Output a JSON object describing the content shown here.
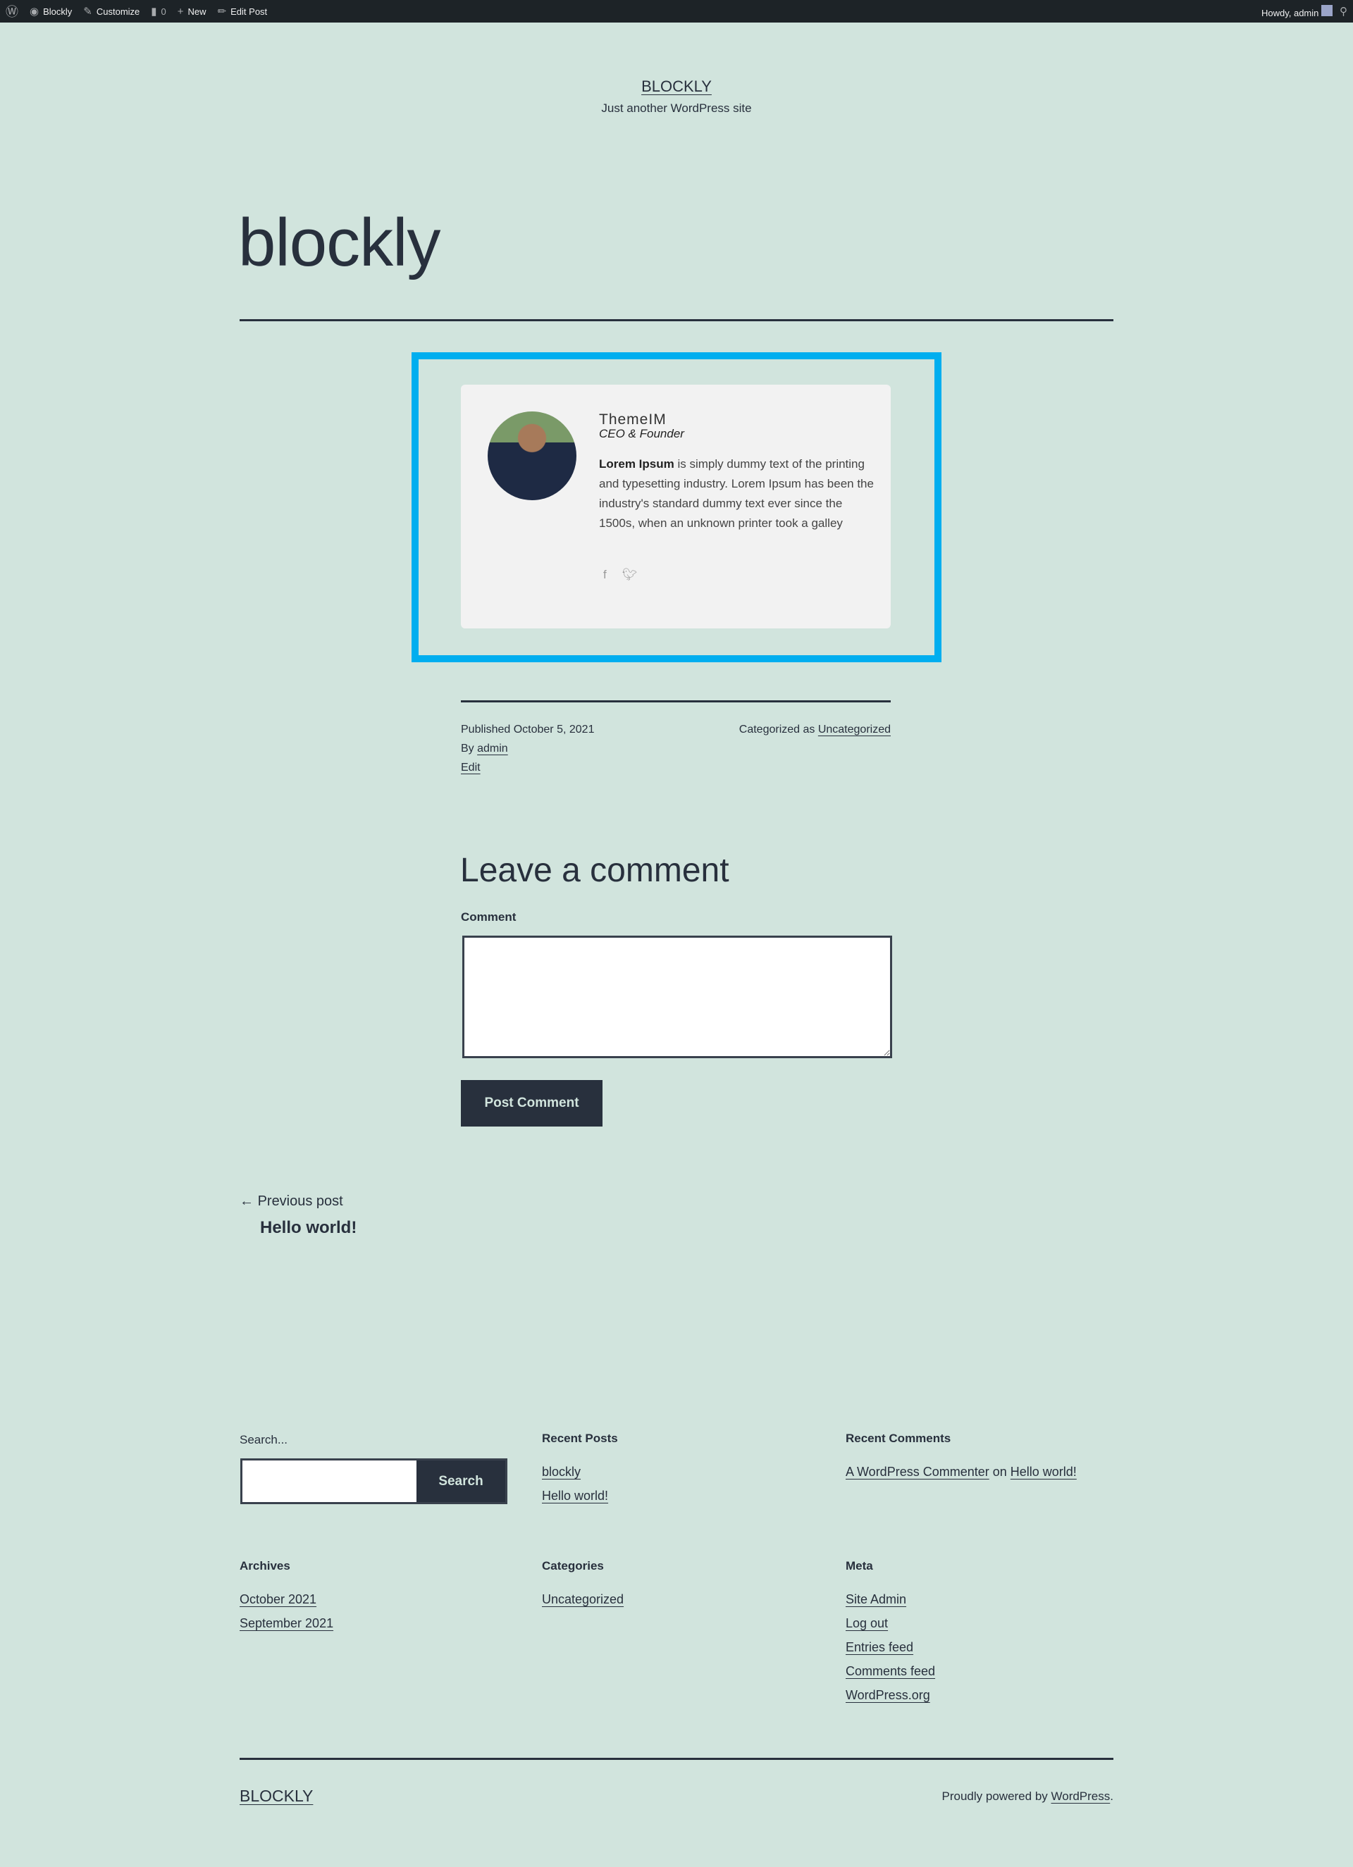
{
  "adminbar": {
    "site": "Blockly",
    "customize": "Customize",
    "comments": "0",
    "new": "New",
    "edit_post": "Edit Post",
    "howdy": "Howdy, admin"
  },
  "site": {
    "title": "BLOCKLY",
    "tagline": "Just another WordPress site"
  },
  "post": {
    "title": "blockly"
  },
  "profile": {
    "name": "ThemeIM",
    "role": "CEO & Founder",
    "bio_bold": "Lorem Ipsum",
    "bio": " is simply dummy text of the printing and typesetting industry. Lorem Ipsum has been the industry's standard dummy text ever since the 1500s, when an unknown printer took a galley",
    "social": [
      "facebook-icon",
      "twitter-icon"
    ],
    "frame_color": "#00aeef"
  },
  "meta": {
    "published": "Published October 5, 2021",
    "by": "By ",
    "author": "admin",
    "edit": "Edit",
    "categorized": "Categorized as ",
    "category": "Uncategorized"
  },
  "comment": {
    "heading": "Leave a comment",
    "label": "Comment",
    "value": "",
    "submit": "Post Comment"
  },
  "nav": {
    "prev_label": "Previous post",
    "prev_title": "Hello world!"
  },
  "footer": {
    "search_label": "Search...",
    "search_value": "",
    "search_button": "Search",
    "recent_posts": {
      "title": "Recent Posts",
      "items": [
        "blockly",
        "Hello world!"
      ]
    },
    "recent_comments": {
      "title": "Recent Comments",
      "author": "A WordPress Commenter",
      "on": " on ",
      "post": "Hello world!"
    },
    "archives": {
      "title": "Archives",
      "items": [
        "October 2021",
        "September 2021"
      ]
    },
    "categories": {
      "title": "Categories",
      "items": [
        "Uncategorized"
      ]
    },
    "meta": {
      "title": "Meta",
      "items": [
        "Site Admin",
        "Log out",
        "Entries feed",
        "Comments feed",
        "WordPress.org"
      ]
    },
    "site_title": "BLOCKLY",
    "powered": "Proudly powered by ",
    "powered_link": "WordPress",
    "powered_end": "."
  }
}
